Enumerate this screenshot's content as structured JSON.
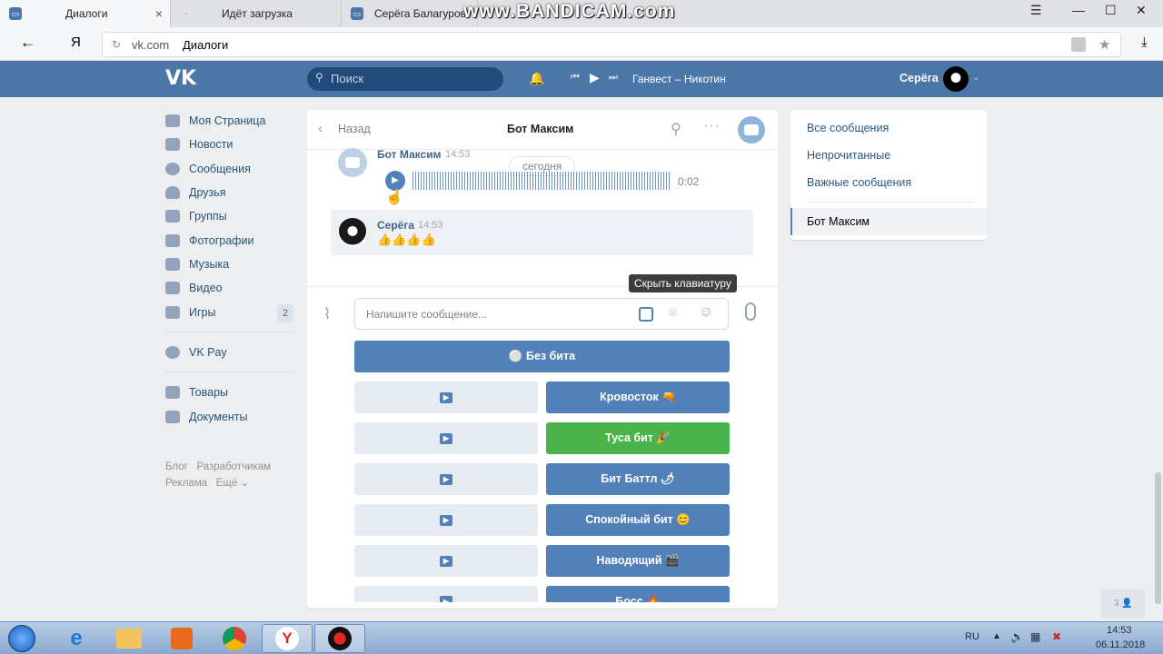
{
  "browser": {
    "tabs": [
      {
        "title": "Диалоги"
      },
      {
        "title": "Идёт загрузка"
      },
      {
        "title": "Серёга Балагуров"
      }
    ],
    "close_glyph": "×",
    "address": {
      "domain": "vk.com",
      "page": "Диалоги"
    },
    "yandex_glyph": "Я",
    "watermark": "www.BANDICAM.com"
  },
  "header": {
    "logo": "VK",
    "search_placeholder": "Поиск",
    "now_playing": "Ганвест – Никотин",
    "user_name": "Серёга"
  },
  "sidebar": {
    "items": [
      {
        "label": "Моя Страница",
        "icon": "home-icon"
      },
      {
        "label": "Новости",
        "icon": "news-icon"
      },
      {
        "label": "Сообщения",
        "icon": "messages-icon"
      },
      {
        "label": "Друзья",
        "icon": "friends-icon"
      },
      {
        "label": "Группы",
        "icon": "groups-icon"
      },
      {
        "label": "Фотографии",
        "icon": "camera-icon"
      },
      {
        "label": "Музыка",
        "icon": "music-icon"
      },
      {
        "label": "Видео",
        "icon": "video-icon"
      },
      {
        "label": "Игры",
        "icon": "games-icon"
      },
      {
        "label": "VK Pay",
        "icon": "vkpay-icon"
      },
      {
        "label": "Товары",
        "icon": "bag-icon"
      },
      {
        "label": "Документы",
        "icon": "document-icon"
      }
    ],
    "games_badge": "2",
    "footer": [
      "Блог",
      "Разработчикам",
      "Реклама",
      "Ещё"
    ]
  },
  "chat": {
    "back_label": "Назад",
    "title": "Бот Максим",
    "date_divider": "сегодня",
    "messages": [
      {
        "author": "Бот Максим",
        "time": "14:53",
        "voice_duration": "0:02"
      },
      {
        "author": "Серёга",
        "time": "14:53",
        "text": "👍👍👍👍"
      }
    ],
    "tooltip": "Скрыть клавиатуру",
    "input_placeholder": "Напишите сообщение...",
    "keyboard": {
      "top": "⚪ Без бита",
      "rows": [
        {
          "right": "Кровосток 🔫",
          "right_color": "primary"
        },
        {
          "right": "Туса бит 🎉",
          "right_color": "positive"
        },
        {
          "right": "Бит Баттл 🌶",
          "right_color": "primary"
        },
        {
          "right": "Спокойный бит 😊",
          "right_color": "primary"
        },
        {
          "right": "Наводящий 🎬",
          "right_color": "primary"
        },
        {
          "right": "Босс 🔥",
          "right_color": "primary"
        }
      ]
    }
  },
  "right_menu": {
    "items": [
      "Все сообщения",
      "Непрочитанные",
      "Важные сообщения"
    ],
    "active": "Бот Максим"
  },
  "online_counter": "3",
  "taskbar": {
    "lang": "RU",
    "time": "14:53",
    "date": "06.11.2018"
  },
  "colors": {
    "vk_blue": "#4a76a8",
    "button_primary": "#5181b8",
    "button_positive": "#4bb34b",
    "button_secondary": "#e5ebf1"
  }
}
